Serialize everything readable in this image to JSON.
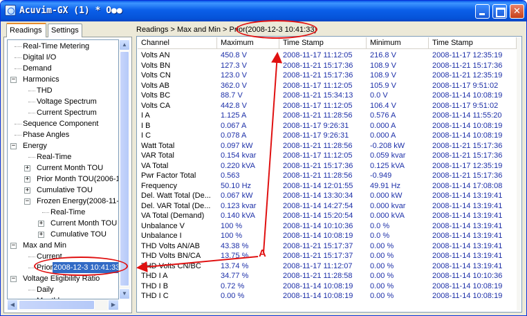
{
  "window": {
    "title": "Acuvim-GX (1) * O●●"
  },
  "tabs": [
    "Readings",
    "Settings"
  ],
  "tree": [
    {
      "label": "Real-Time Metering",
      "level": 1
    },
    {
      "label": "Digital I/O",
      "level": 1
    },
    {
      "label": "Demand",
      "level": 1
    },
    {
      "label": "Harmonics",
      "level": 0,
      "exp": "-"
    },
    {
      "label": "THD",
      "level": 2
    },
    {
      "label": "Voltage Spectrum",
      "level": 2
    },
    {
      "label": "Current Spectrum",
      "level": 2
    },
    {
      "label": "Sequence Component",
      "level": 1
    },
    {
      "label": "Phase Angles",
      "level": 1
    },
    {
      "label": "Energy",
      "level": 0,
      "exp": "-"
    },
    {
      "label": "Real-Time",
      "level": 2
    },
    {
      "label": "Current Month TOU",
      "level": 2,
      "exp": "+"
    },
    {
      "label": "Prior Month TOU(2006-1",
      "level": 2,
      "exp": "+"
    },
    {
      "label": "Cumulative TOU",
      "level": 2,
      "exp": "+"
    },
    {
      "label": "Frozen Energy(2008-11-",
      "level": 2,
      "exp": "-"
    },
    {
      "label": "Real-Time",
      "level": 3
    },
    {
      "label": "Current Month TOU",
      "level": 3,
      "exp": "+"
    },
    {
      "label": "Cumulative TOU",
      "level": 3,
      "exp": "+"
    },
    {
      "label": "Max and Min",
      "level": 0,
      "exp": "-"
    },
    {
      "label": "Current",
      "level": 2
    },
    {
      "label": "Prior",
      "selected": "2008-12-3 10:41:33",
      "level": 2
    },
    {
      "label": "Voltage Eligibility Ratio",
      "level": 0,
      "exp": "-"
    },
    {
      "label": "Daily",
      "level": 2
    },
    {
      "label": "Monthly",
      "level": 2
    }
  ],
  "breadcrumb": "Readings > Max and Min > Prior(2008-12-3 10:41:33)",
  "columns": [
    "Channel",
    "Maximum",
    "Time Stamp",
    "Minimum",
    "Time Stamp"
  ],
  "rows": [
    [
      "Volts AN",
      "450.8 V",
      "2008-11-17 11:12:05",
      "216.8 V",
      "2008-11-17 12:35:19"
    ],
    [
      "Volts BN",
      "127.3 V",
      "2008-11-21 15:17:36",
      "108.9 V",
      "2008-11-21 15:17:36"
    ],
    [
      "Volts CN",
      "123.0 V",
      "2008-11-21 15:17:36",
      "108.9 V",
      "2008-11-21 12:35:19"
    ],
    [
      "Volts AB",
      "362.0 V",
      "2008-11-17 11:12:05",
      "105.9 V",
      "2008-11-17 9:51:02"
    ],
    [
      "Volts BC",
      "88.7 V",
      "2008-11-21 15:34:13",
      "0.0 V",
      "2008-11-14 10:08:19"
    ],
    [
      "Volts CA",
      "442.8 V",
      "2008-11-17 11:12:05",
      "106.4 V",
      "2008-11-17 9:51:02"
    ],
    [
      "I A",
      "1.125 A",
      "2008-11-21 11:28:56",
      "0.576 A",
      "2008-11-14 11:55:20"
    ],
    [
      "I B",
      "0.067 A",
      "2008-11-17 9:26:31",
      "0.000 A",
      "2008-11-14 10:08:19"
    ],
    [
      "I C",
      "0.078 A",
      "2008-11-17 9:26:31",
      "0.000 A",
      "2008-11-14 10:08:19"
    ],
    [
      "Watt Total",
      "0.097 kW",
      "2008-11-21 11:28:56",
      "-0.208 kW",
      "2008-11-21 15:17:36"
    ],
    [
      "VAR Total",
      "0.154 kvar",
      "2008-11-17 11:12:05",
      "0.059 kvar",
      "2008-11-21 15:17:36"
    ],
    [
      "VA Total",
      "0.220 kVA",
      "2008-11-21 15:17:36",
      "0.125 kVA",
      "2008-11-17 12:35:19"
    ],
    [
      "Pwr Factor Total",
      "0.563",
      "2008-11-21 11:28:56",
      "-0.949",
      "2008-11-21 15:17:36"
    ],
    [
      "Frequency",
      "50.10 Hz",
      "2008-11-14 12:01:55",
      "49.91 Hz",
      "2008-11-14 17:08:08"
    ],
    [
      "Del. Watt Total (De...",
      "0.067 kW",
      "2008-11-14 13:30:34",
      "0.000 kW",
      "2008-11-14 13:19:41"
    ],
    [
      "Del. VAR Total (De...",
      "0.123 kvar",
      "2008-11-14 14:27:54",
      "0.000 kvar",
      "2008-11-14 13:19:41"
    ],
    [
      "VA Total (Demand)",
      "0.140 kVA",
      "2008-11-14 15:20:54",
      "0.000 kVA",
      "2008-11-14 13:19:41"
    ],
    [
      "Unbalance V",
      "100 %",
      "2008-11-14 10:10:36",
      "0.0 %",
      "2008-11-14 13:19:41"
    ],
    [
      "Unbalance I",
      "100 %",
      "2008-11-14 10:08:19",
      "0.0 %",
      "2008-11-14 13:19:41"
    ],
    [
      "THD Volts AN/AB",
      "43.38 %",
      "2008-11-21 15:17:37",
      "0.00 %",
      "2008-11-14 13:19:41"
    ],
    [
      "THD Volts BN/CA",
      "13.75 %",
      "2008-11-21 15:17:37",
      "0.00 %",
      "2008-11-14 13:19:41"
    ],
    [
      "THD Volts CN/BC",
      "13.74 %",
      "2008-11-17 11:12:07",
      "0.00 %",
      "2008-11-14 13:19:41"
    ],
    [
      "THD I A",
      "34.77 %",
      "2008-11-21 11:28:58",
      "0.00 %",
      "2008-11-14 10:10:36"
    ],
    [
      "THD I B",
      "0.72 %",
      "2008-11-14 10:08:19",
      "0.00 %",
      "2008-11-14 10:08:19"
    ],
    [
      "THD I C",
      "0.00 %",
      "2008-11-14 10:08:19",
      "0.00 %",
      "2008-11-14 10:08:19"
    ]
  ],
  "annotation": {
    "label": "A",
    "color": "#e01010"
  }
}
